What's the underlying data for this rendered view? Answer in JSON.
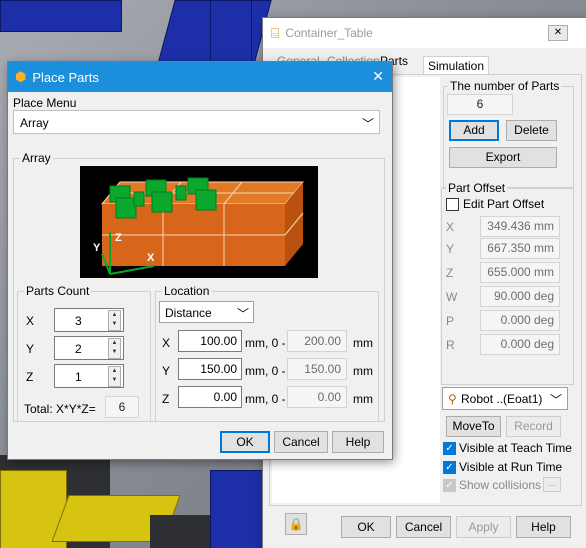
{
  "colors": {
    "accent": "#0078d7",
    "dialog_title_bg": "#1c8fdc",
    "box_orange": "#d8661a",
    "part_green": "#0aa82c"
  },
  "container_table": {
    "title": "Container_Table",
    "tabs": [
      "General",
      "Collection",
      "Parts",
      "Simulation"
    ],
    "number_of_parts": {
      "label": "The number of Parts",
      "value": "6"
    },
    "add_label": "Add",
    "delete_label": "Delete",
    "export_label": "Export",
    "part_offset": {
      "label": "Part Offset",
      "edit_label": "Edit Part Offset",
      "rows": [
        {
          "axis": "X",
          "value": "349.436 mm"
        },
        {
          "axis": "Y",
          "value": "667.350 mm"
        },
        {
          "axis": "Z",
          "value": "655.000 mm"
        },
        {
          "axis": "W",
          "value": "90.000 deg"
        },
        {
          "axis": "P",
          "value": "0.000 deg"
        },
        {
          "axis": "R",
          "value": "0.000 deg"
        }
      ]
    },
    "robot_select": "Robot ..(Eoat1)",
    "moveto_label": "MoveTo",
    "record_label": "Record",
    "visible_teach": "Visible at Teach Time",
    "visible_run": "Visible at Run Time",
    "show_collisions": "Show collisions",
    "ellipsis": "...",
    "ok_label": "OK",
    "cancel_label": "Cancel",
    "apply_label": "Apply",
    "help_label": "Help",
    "close_glyph": "✕"
  },
  "place_parts": {
    "title": "Place Parts",
    "close_glyph": "✕",
    "place_menu": {
      "label": "Place Menu",
      "value": "Array"
    },
    "array_label": "Array",
    "preview_axes": {
      "x": "X",
      "y": "Y",
      "z": "Z"
    },
    "parts_count": {
      "label": "Parts Count",
      "rows": [
        {
          "axis": "X",
          "value": "3"
        },
        {
          "axis": "Y",
          "value": "2"
        },
        {
          "axis": "Z",
          "value": "1"
        }
      ],
      "total_label": "Total: X*Y*Z=",
      "total_value": "6"
    },
    "location": {
      "label": "Location",
      "mode": "Distance",
      "rows": [
        {
          "axis": "X",
          "value": "100.00",
          "unit": "mm, 0 -",
          "max": "200.00",
          "max_unit": "mm"
        },
        {
          "axis": "Y",
          "value": "150.00",
          "unit": "mm, 0 -",
          "max": "150.00",
          "max_unit": "mm"
        },
        {
          "axis": "Z",
          "value": "0.00",
          "unit": "mm, 0 -",
          "max": "0.00",
          "max_unit": "mm"
        }
      ]
    },
    "ok_label": "OK",
    "cancel_label": "Cancel",
    "help_label": "Help"
  }
}
